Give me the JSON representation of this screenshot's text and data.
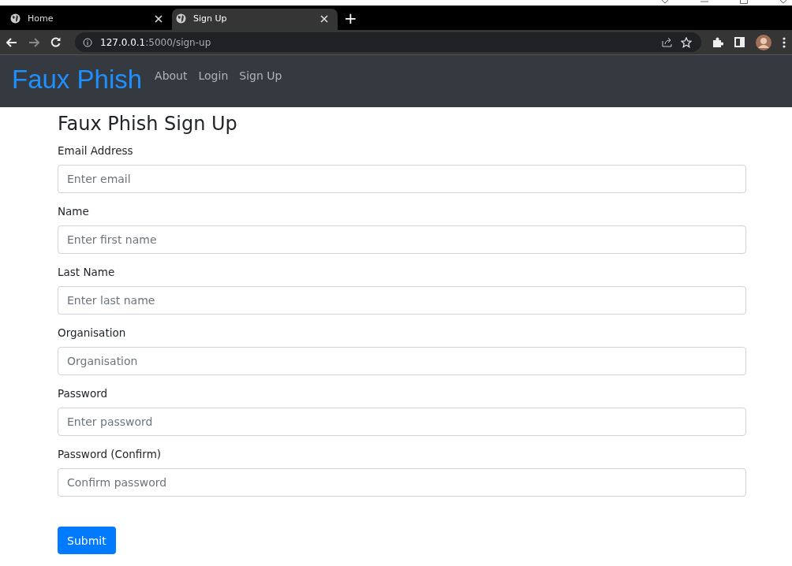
{
  "browser": {
    "tabs": [
      {
        "title": "Home",
        "selected": false
      },
      {
        "title": "Sign Up",
        "selected": true
      }
    ],
    "new_tab": "+",
    "url_host": "127.0.0.1",
    "url_path": ":5000/sign-up"
  },
  "navbar": {
    "brand": "Faux Phish",
    "links": [
      {
        "label": "About"
      },
      {
        "label": "Login"
      },
      {
        "label": "Sign Up"
      }
    ]
  },
  "form": {
    "heading": "Faux Phish Sign Up",
    "fields": [
      {
        "label": "Email Address",
        "placeholder": "Enter email"
      },
      {
        "label": "Name",
        "placeholder": "Enter first name"
      },
      {
        "label": "Last Name",
        "placeholder": "Enter last name"
      },
      {
        "label": "Organisation",
        "placeholder": "Organisation"
      },
      {
        "label": "Password",
        "placeholder": "Enter password"
      },
      {
        "label": "Password (Confirm)",
        "placeholder": "Confirm password"
      }
    ],
    "submit": "Submit"
  }
}
